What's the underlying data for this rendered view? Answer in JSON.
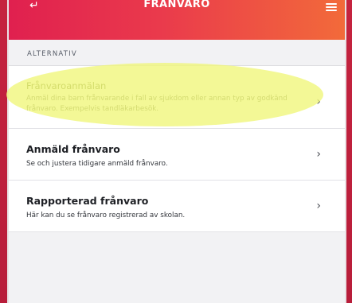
{
  "header": {
    "title": "FRÅNVARO",
    "back_icon": "back-arrow-icon",
    "menu_icon": "hamburger-menu-icon",
    "back_glyph": "↵"
  },
  "section": {
    "label": "ALTERNATIV"
  },
  "items": [
    {
      "title": "Frånvaroanmälan",
      "description": "Anmäl dina barn frånvarande i fall av sjukdom eller annan typ av godkänd frånvaro. Exempelvis tandläkarbesök.",
      "chevron": "›"
    },
    {
      "title": "Anmäld frånvaro",
      "description": "Se och justera tidigare anmäld frånvaro.",
      "chevron": "›"
    },
    {
      "title": "Rapporterad frånvaro",
      "description": "Här kan du se frånvaro registrerad av skolan.",
      "chevron": "›"
    }
  ],
  "colors": {
    "header_start": "#e0204f",
    "header_end": "#f26a3a",
    "highlight": "#f0f678",
    "frame": "#c5233f"
  }
}
